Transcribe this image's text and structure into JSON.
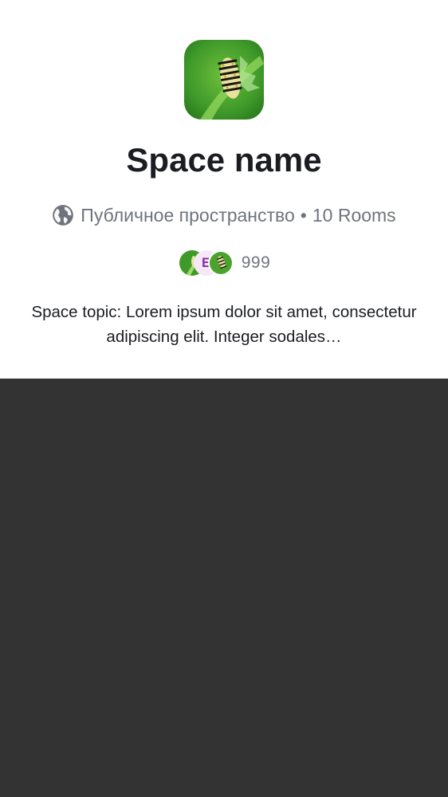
{
  "space": {
    "name": "Space name",
    "visibility": "Публичное пространство",
    "separator": "•",
    "rooms": "10 Rooms",
    "member_count": "999",
    "member_avatar_initial": "E",
    "topic": "Space topic: Lorem ipsum dolor sit amet, consectetur adipiscing elit. Integer sodales…"
  },
  "icons": {
    "visibility_icon": "globe-icon"
  },
  "colors": {
    "card_background": "#ffffff",
    "page_background": "#333333",
    "title_text": "#1b1d22",
    "secondary_text": "#6f747c",
    "initial_avatar_text": "#8b2aa8",
    "initial_avatar_bg": "#f5e9f7"
  }
}
